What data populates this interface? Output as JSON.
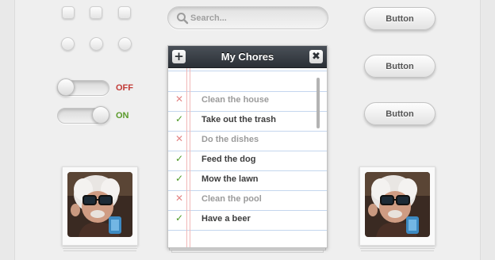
{
  "search": {
    "placeholder": "Search..."
  },
  "toggles": [
    {
      "label": "OFF",
      "state": "off",
      "color": "#c23a36"
    },
    {
      "label": "ON",
      "state": "on",
      "color": "#5a9a2a"
    }
  ],
  "buttons": [
    {
      "label": "Button"
    },
    {
      "label": "Button"
    },
    {
      "label": "Button"
    }
  ],
  "chores": {
    "title": "My Chores",
    "add_icon": "plus-icon",
    "close_icon": "close-icon",
    "items": [
      {
        "text": "Clean the house",
        "done": false
      },
      {
        "text": "Take out the trash",
        "done": true
      },
      {
        "text": "Do the dishes",
        "done": false
      },
      {
        "text": "Feed the dog",
        "done": true
      },
      {
        "text": "Mow the lawn",
        "done": true
      },
      {
        "text": "Clean the pool",
        "done": false
      },
      {
        "text": "Have a beer",
        "done": true
      }
    ]
  },
  "colors": {
    "check": "#4e9a26",
    "cross": "#e38686",
    "done_text": "#3d3d3d",
    "pending_text": "#9b9b9b"
  }
}
